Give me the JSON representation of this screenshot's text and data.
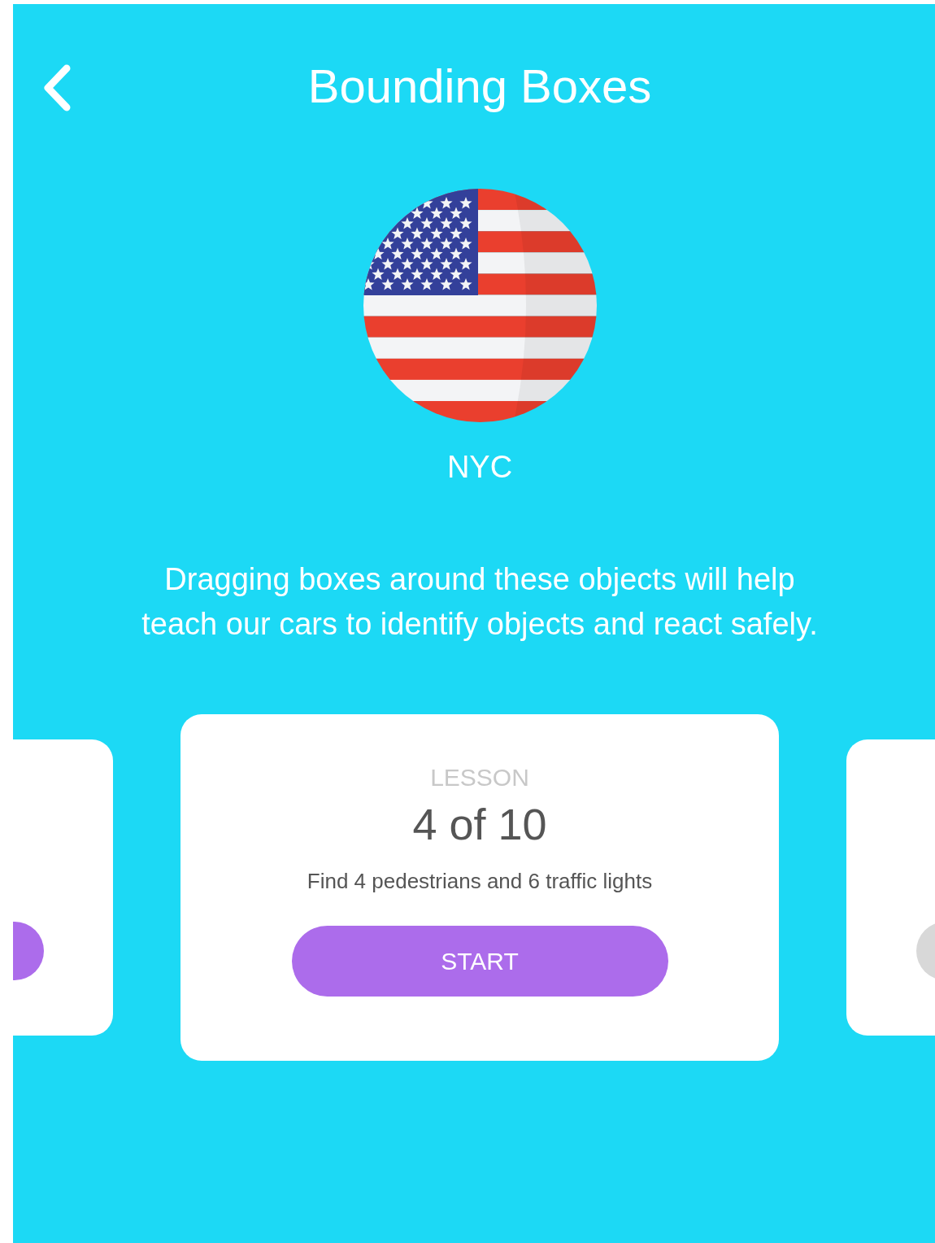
{
  "header": {
    "title": "Bounding Boxes"
  },
  "city": {
    "name": "NYC"
  },
  "description": "Dragging boxes around these objects will help teach our cars to identify objects and react safely.",
  "lessons": [
    {
      "selected": false,
      "disabled": false
    },
    {
      "selected": true,
      "disabled": false,
      "label": "LESSON",
      "number": "4 of 10",
      "task": "Find 4 pedestrians and 6 traffic lights",
      "button": "START"
    },
    {
      "selected": false,
      "disabled": true
    }
  ]
}
